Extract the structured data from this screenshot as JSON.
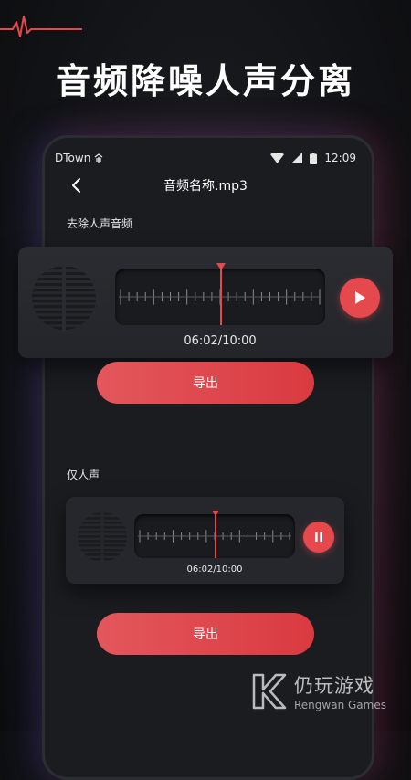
{
  "headline": "音频降噪人声分离",
  "status_bar": {
    "carrier": "DTown",
    "time": "12:09"
  },
  "header": {
    "title": "音频名称.mp3"
  },
  "sections": [
    {
      "label": "去除人声音频",
      "player_state": "paused",
      "time": "06:02/10:00",
      "progress": 0.502,
      "export_label": "导出"
    },
    {
      "label": "仅人声",
      "player_state": "playing",
      "time": "06:02/10:00",
      "progress": 0.502,
      "export_label": "导出"
    }
  ],
  "watermark": {
    "cn": "仍玩游戏",
    "en": "Rengwan Games"
  },
  "colors": {
    "accent": "#e5484d",
    "background": "#121316",
    "card": "#2b2c31"
  },
  "icons": [
    "pulse-line-icon",
    "back-chevron-icon",
    "wifi-icon",
    "signal-icon",
    "battery-icon",
    "play-icon",
    "pause-icon",
    "speaker-grille-icon"
  ]
}
